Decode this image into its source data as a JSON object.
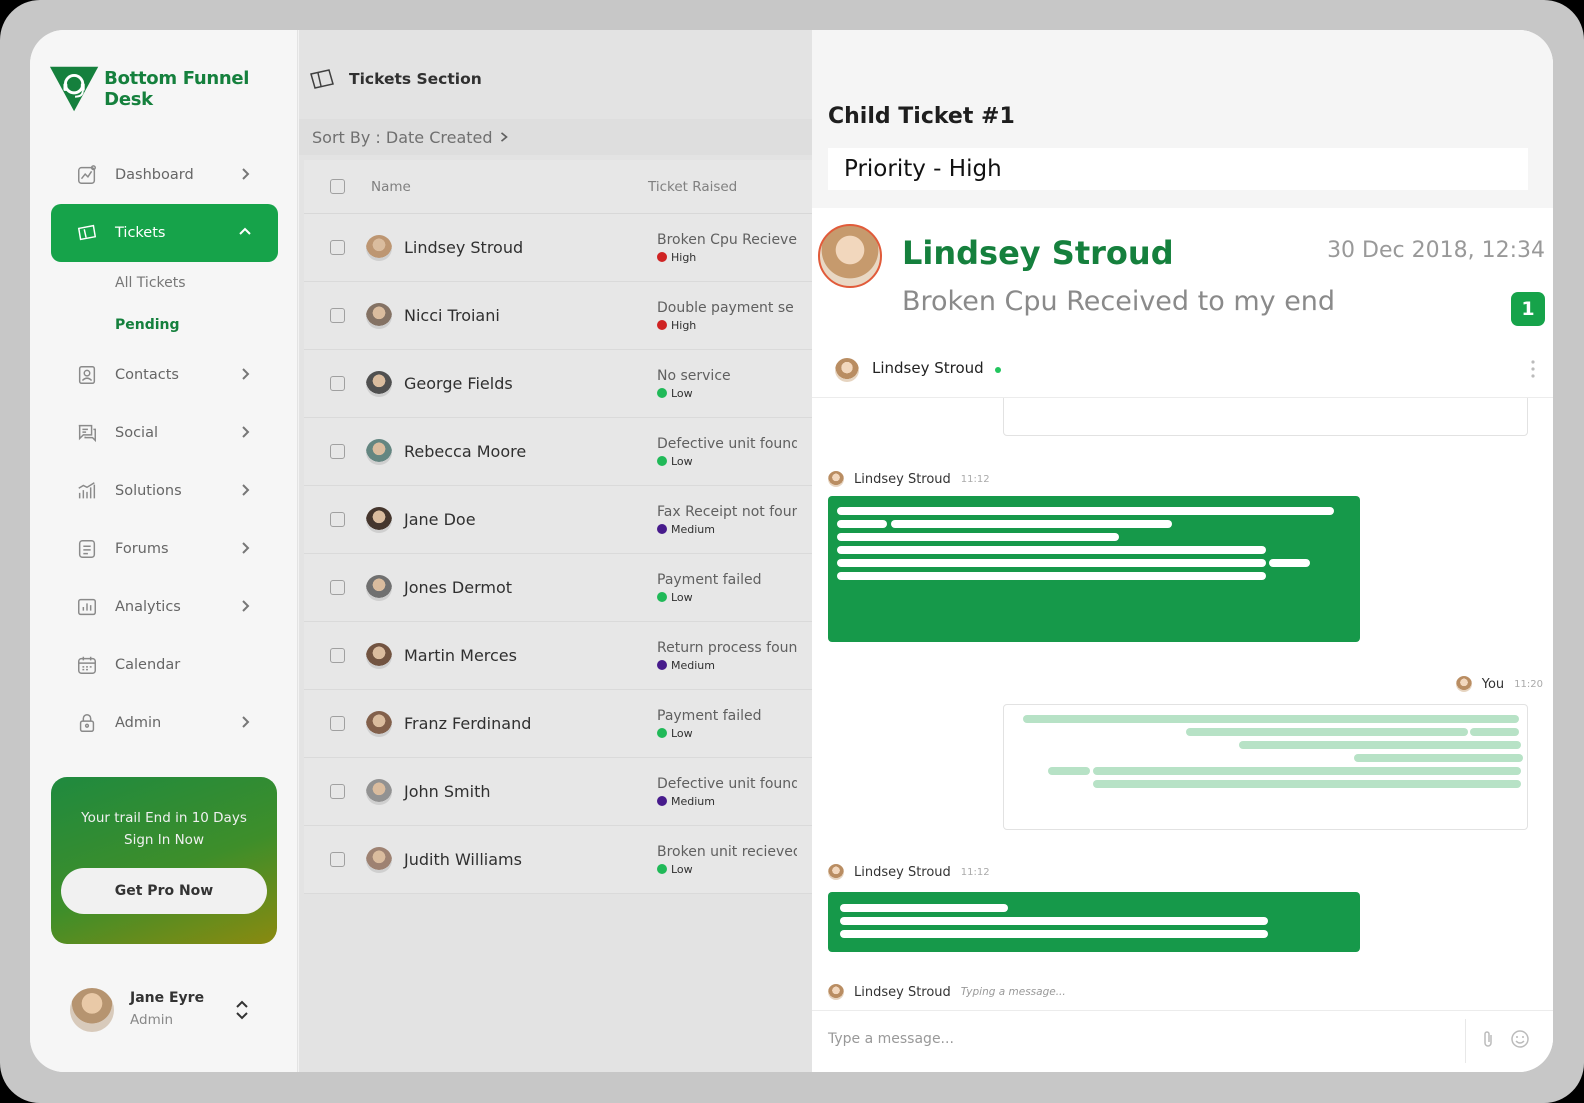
{
  "brand": {
    "name": "Bottom Funnel Desk",
    "color": "#15803d"
  },
  "sidebar": {
    "items": [
      {
        "label": "Dashboard",
        "icon": "chart-line-icon"
      },
      {
        "label": "Tickets",
        "icon": "ticket-icon",
        "active": true
      },
      {
        "label": "Contacts",
        "icon": "contact-card-icon"
      },
      {
        "label": "Social",
        "icon": "chat-bubbles-icon"
      },
      {
        "label": "Solutions",
        "icon": "bar-chart-icon"
      },
      {
        "label": "Forums",
        "icon": "document-icon"
      },
      {
        "label": "Analytics",
        "icon": "analytics-icon"
      },
      {
        "label": "Calendar",
        "icon": "calendar-icon"
      },
      {
        "label": "Admin",
        "icon": "lock-icon"
      }
    ],
    "ticket_sub": {
      "all": "All Tickets",
      "pending": "Pending"
    },
    "promo": {
      "line1": "Your trail End in 10 Days",
      "line2": "Sign In Now",
      "button": "Get Pro Now"
    },
    "user": {
      "name": "Jane Eyre",
      "role": "Admin"
    }
  },
  "list": {
    "title": "Tickets Section",
    "sort_label": "Sort By : Date Created",
    "columns": {
      "name": "Name",
      "ticket": "Ticket Raised"
    },
    "rows": [
      {
        "name": "Lindsey Stroud",
        "ticket": "Broken Cpu Recieved",
        "priority": "High",
        "color": "#dc2626"
      },
      {
        "name": "Nicci Troiani",
        "ticket": "Double payment se",
        "priority": "High",
        "color": "#dc2626"
      },
      {
        "name": "George Fields",
        "ticket": "No service",
        "priority": "Low",
        "color": "#22c55e"
      },
      {
        "name": "Rebecca Moore",
        "ticket": "Defective unit found",
        "priority": "Low",
        "color": "#22c55e"
      },
      {
        "name": "Jane Doe",
        "ticket": "Fax Receipt not foun",
        "priority": "Medium",
        "color": "#4c1d95"
      },
      {
        "name": "Jones Dermot",
        "ticket": "Payment failed",
        "priority": "Low",
        "color": "#22c55e"
      },
      {
        "name": "Martin Merces",
        "ticket": "Return process foun",
        "priority": "Medium",
        "color": "#4c1d95"
      },
      {
        "name": "Franz Ferdinand",
        "ticket": "Payment failed",
        "priority": "Low",
        "color": "#22c55e"
      },
      {
        "name": "John Smith",
        "ticket": "Defective unit found",
        "priority": "Medium",
        "color": "#4c1d95"
      },
      {
        "name": "Judith Williams",
        "ticket": "Broken unit recieved",
        "priority": "Low",
        "color": "#22c55e"
      }
    ]
  },
  "panel": {
    "title": "Child Ticket #1",
    "priority": "Priority  - High",
    "customer": "Lindsey Stroud",
    "date": "30 Dec 2018, 12:34",
    "subject": "Broken Cpu Received to my end",
    "badge": "1",
    "chat_with": "Lindsey Stroud",
    "messages": [
      {
        "sender": "Lindsey Stroud",
        "time": "11:12"
      },
      {
        "sender": "You",
        "time": "11:20"
      },
      {
        "sender": "Lindsey Stroud",
        "time": "11:12"
      },
      {
        "sender": "Lindsey Stroud",
        "typing": "Typing a message..."
      }
    ],
    "composer_placeholder": "Type a message..."
  }
}
